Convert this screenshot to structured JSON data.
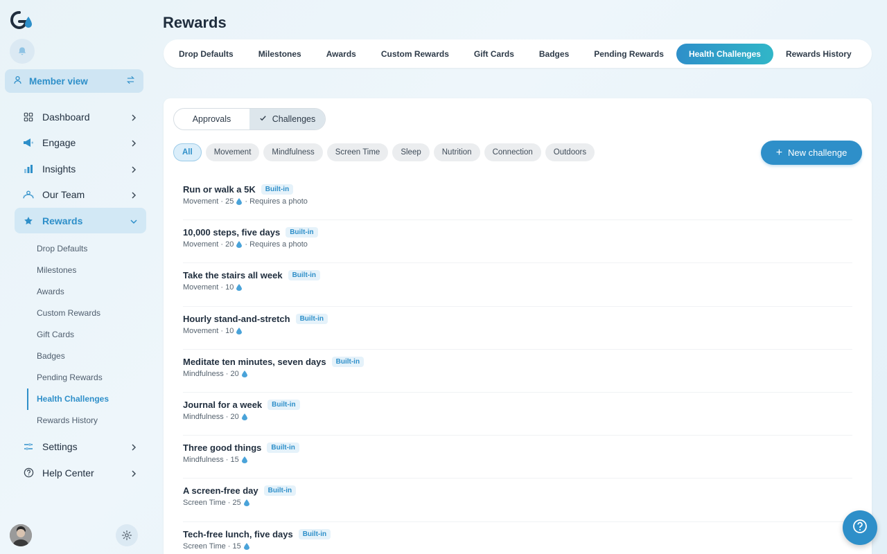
{
  "sidebar": {
    "member_view": "Member view",
    "nav": [
      {
        "label": "Dashboard"
      },
      {
        "label": "Engage"
      },
      {
        "label": "Insights"
      },
      {
        "label": "Our Team"
      },
      {
        "label": "Rewards"
      }
    ],
    "rewards_sub": [
      "Drop Defaults",
      "Milestones",
      "Awards",
      "Custom Rewards",
      "Gift Cards",
      "Badges",
      "Pending Rewards",
      "Health Challenges",
      "Rewards History"
    ],
    "nav_bottom": [
      {
        "label": "Settings"
      },
      {
        "label": "Help Center"
      }
    ]
  },
  "page": {
    "title": "Rewards"
  },
  "tabs": [
    "Drop Defaults",
    "Milestones",
    "Awards",
    "Custom Rewards",
    "Gift Cards",
    "Badges",
    "Pending Rewards",
    "Health Challenges",
    "Rewards History"
  ],
  "segment": {
    "left": "Approvals",
    "right": "Challenges"
  },
  "filters": [
    "All",
    "Movement",
    "Mindfulness",
    "Screen Time",
    "Sleep",
    "Nutrition",
    "Connection",
    "Outdoors"
  ],
  "new_challenge": "New challenge",
  "challenges": [
    {
      "title": "Run or walk a 5K",
      "badge": "Built-in",
      "category": "Movement · 25",
      "extra": "· Requires a photo"
    },
    {
      "title": "10,000 steps, five days",
      "badge": "Built-in",
      "category": "Movement · 20",
      "extra": "· Requires a photo"
    },
    {
      "title": "Take the stairs all week",
      "badge": "Built-in",
      "category": "Movement · 10",
      "extra": ""
    },
    {
      "title": "Hourly stand-and-stretch",
      "badge": "Built-in",
      "category": "Movement · 10",
      "extra": ""
    },
    {
      "title": "Meditate ten minutes, seven days",
      "badge": "Built-in",
      "category": "Mindfulness · 20",
      "extra": ""
    },
    {
      "title": "Journal for a week",
      "badge": "Built-in",
      "category": "Mindfulness · 20",
      "extra": ""
    },
    {
      "title": "Three good things",
      "badge": "Built-in",
      "category": "Mindfulness · 15",
      "extra": ""
    },
    {
      "title": "A screen-free day",
      "badge": "Built-in",
      "category": "Screen Time · 25",
      "extra": ""
    },
    {
      "title": "Tech-free lunch, five days",
      "badge": "Built-in",
      "category": "Screen Time · 15",
      "extra": ""
    }
  ],
  "colors": {
    "accent": "#2e8fc9",
    "accent_light": "#d2e8f5"
  }
}
